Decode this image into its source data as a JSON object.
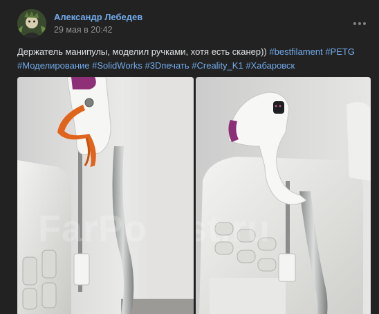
{
  "post": {
    "author": "Александр Лебедев",
    "date": "29 мая в 20:42",
    "text_before": "Держатель манипулы, моделил ручками, хотя есть сканер)) ",
    "hashtags": [
      "#bestfilament",
      "#PETG",
      "#Моделирование",
      "#SolidWorks",
      "#3Dпечать",
      "#Creality_K1",
      "#Хабаровск"
    ],
    "more_icon": "more-horizontal-icon"
  },
  "photos": {
    "watermark_left": "FarPo",
    "watermark_right": "st.ru"
  },
  "colors": {
    "background": "#222222",
    "link": "#71aaeb",
    "text": "#e1e3e6",
    "muted": "#939393"
  }
}
